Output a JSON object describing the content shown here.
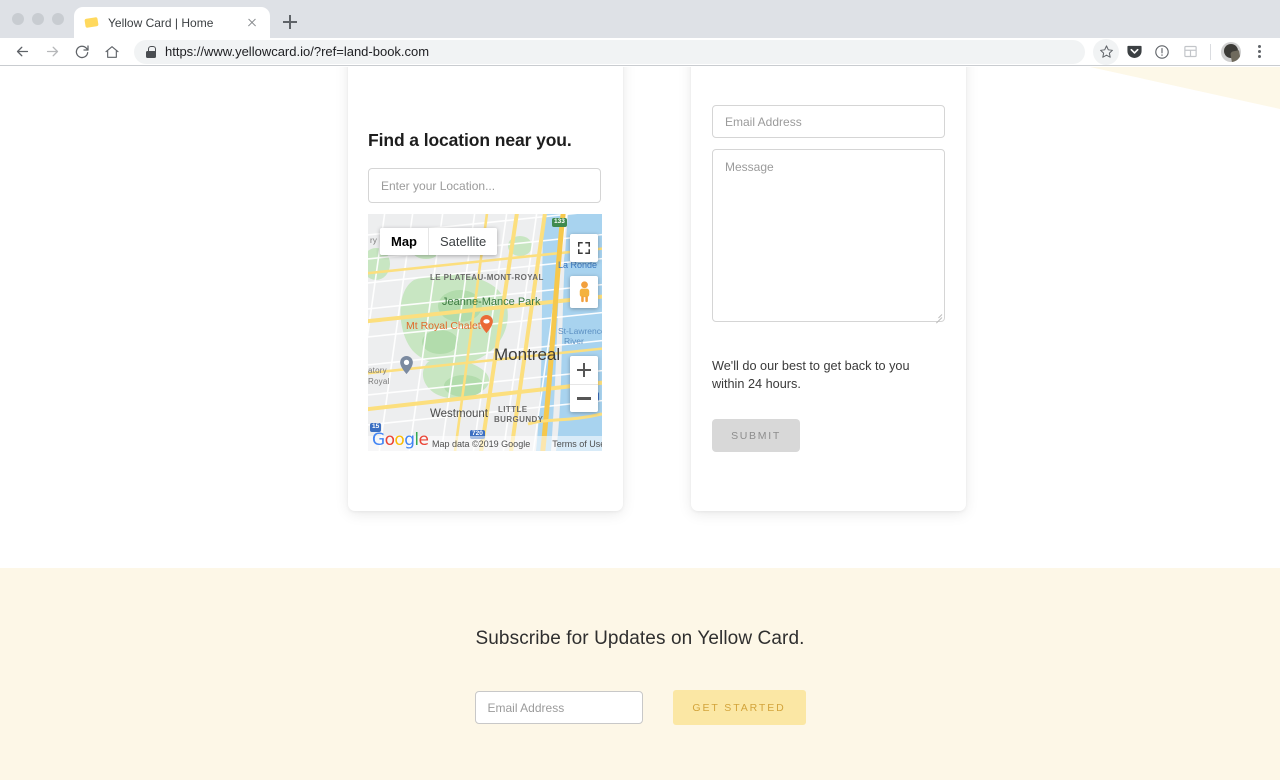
{
  "browser": {
    "tab": {
      "title": "Yellow Card | Home",
      "favicon_icon": "yellow-card-icon"
    },
    "newtab_label": "+",
    "address": {
      "url_secure": "https://www.yellowcard.io",
      "url_rest": "/?ref=land-book.com",
      "full_url": "https://www.yellowcard.io/?ref=land-book.com"
    },
    "toolbar_icons": [
      "back-icon",
      "forward-icon",
      "reload-icon",
      "home-icon",
      "star-icon",
      "pocket-icon",
      "info-circle-icon",
      "split-panel-icon",
      "profile-avatar",
      "kebab-menu-icon"
    ]
  },
  "location_card": {
    "title": "Find a location near you.",
    "input_placeholder": "Enter your Location...",
    "input_value": "",
    "map": {
      "type_buttons": [
        {
          "label": "Map",
          "active": true
        },
        {
          "label": "Satellite",
          "active": false
        }
      ],
      "controls": [
        "fullscreen-icon",
        "pegman-icon",
        "zoom-in-icon",
        "zoom-out-icon"
      ],
      "attribution": "Map data ©2019 Google",
      "terms_label": "Terms of Use",
      "logo_letters": [
        "G",
        "o",
        "o",
        "g",
        "l",
        "e"
      ],
      "labels": {
        "neighborhood": "LE PLATEAU-MONT-ROYAL",
        "park": "Jeanne-Mance Park",
        "poi": "Mt Royal Chalet",
        "city": "Montreal",
        "town": "Westmount",
        "district_line1": "LITTLE",
        "district_line2": "BURGUNDY",
        "water_line1": "St-Lawrence",
        "water_line2": "River",
        "island": "La Ronde",
        "observatory_line1": "atory",
        "observatory_line2": "Royal",
        "left_edge": "ry",
        "shield_15": "15",
        "shield_720": "720",
        "shield_top": "133",
        "shield_right": "1"
      }
    }
  },
  "contact_card": {
    "email_placeholder": "Email Address",
    "email_value": "",
    "message_placeholder": "Message",
    "message_value": "",
    "note": "We'll do our best to get back to you within 24 hours.",
    "submit_label": "SUBMIT"
  },
  "subscribe": {
    "title": "Subscribe for Updates on Yellow Card.",
    "email_placeholder": "Email Address",
    "email_value": "",
    "button_label": "GET STARTED"
  },
  "colors": {
    "cream_bg": "#fdf7e7",
    "button_yellow": "#fbe7a4",
    "button_yellow_text": "#d3a43b",
    "favicon_yellow": "#ffd95e",
    "submit_gray": "#d8d8d8"
  }
}
